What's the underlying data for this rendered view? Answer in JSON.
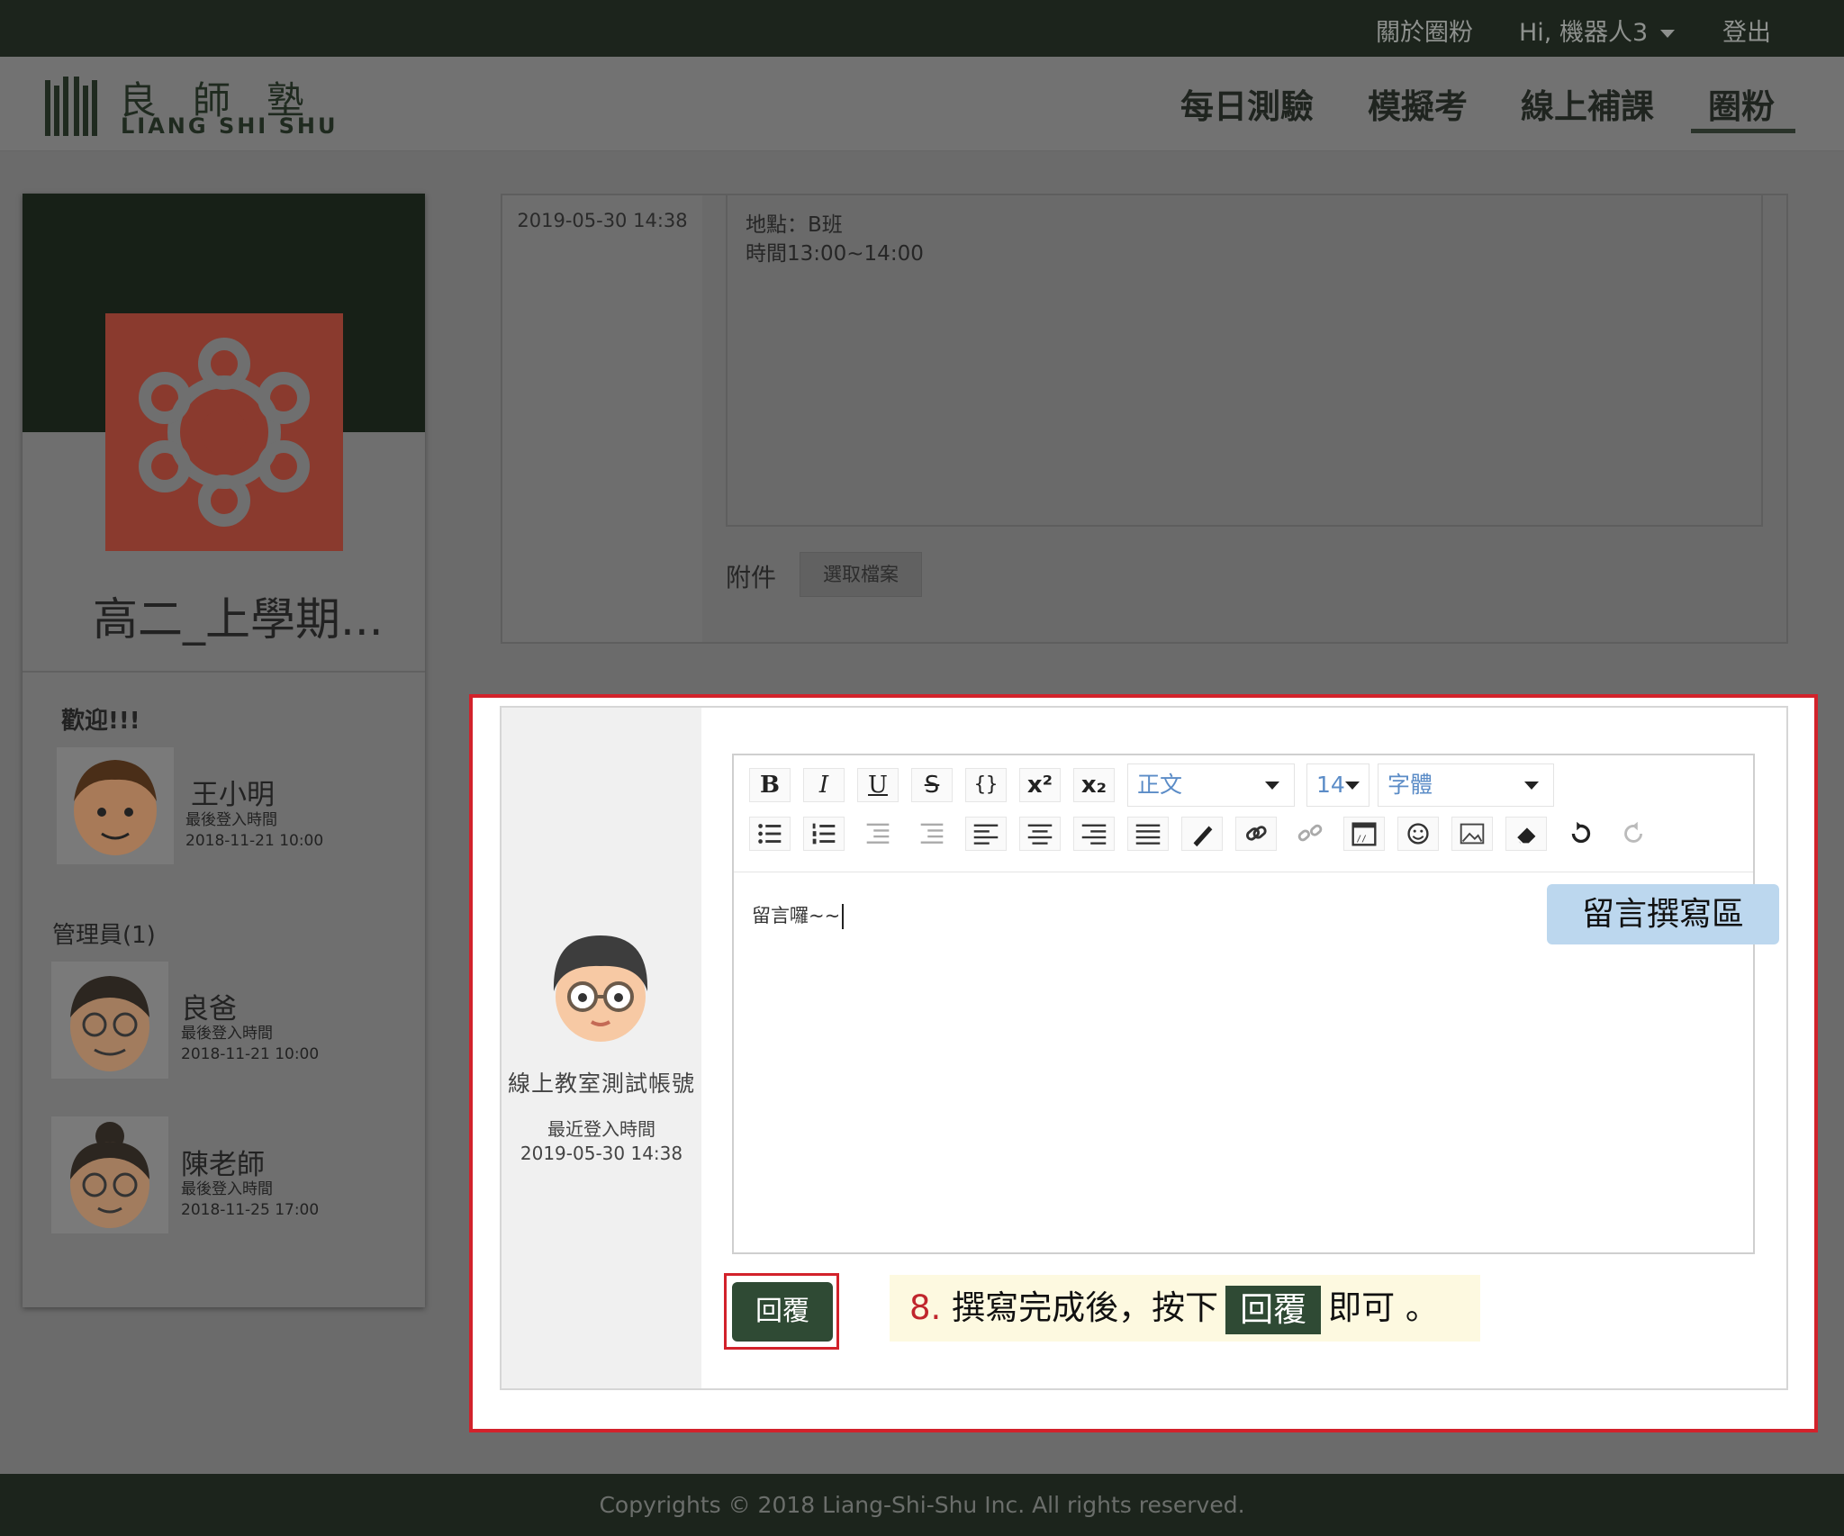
{
  "topbar": {
    "about": "關於圈粉",
    "greeting": "Hi, 機器人3",
    "logout": "登出"
  },
  "logo": {
    "cn": "良師塾",
    "en": "LIANG SHI SHU"
  },
  "nav": {
    "items": [
      "每日測驗",
      "模擬考",
      "線上補課",
      "圈粉"
    ],
    "active": "圈粉"
  },
  "sidebar": {
    "group_name": "高二_上學期...",
    "welcome": "歡迎!!!",
    "member": {
      "name": "王小明",
      "login_label": "最後登入時間",
      "login_time": "2018-11-21 10:00"
    },
    "admins_heading": "管理員(1)",
    "admins": [
      {
        "name": "良爸",
        "login_label": "最後登入時間",
        "login_time": "2018-11-21 10:00"
      },
      {
        "name": "陳老師",
        "login_label": "最後登入時間",
        "login_time": "2018-11-25 17:00"
      }
    ]
  },
  "upper_post": {
    "date": "2019-05-30 14:38",
    "lines": [
      "地點：B班",
      "時間13:00~14:00"
    ],
    "attach_label": "附件",
    "file_button": "選取檔案"
  },
  "reply": {
    "author": "線上教室測試帳號",
    "login_label": "最近登入時間",
    "login_time": "2019-05-30 14:38",
    "editor": {
      "format": "正文",
      "size": "14",
      "font": "字體",
      "content": "留言囉~~"
    },
    "button": "回覆"
  },
  "annotations": {
    "editor_label": "留言撰寫區",
    "step_number": "8.",
    "step_text_before": "撰寫完成後，按下",
    "step_pill": "回覆",
    "step_text_after": "即可 。"
  },
  "footer": {
    "copyright": "Copyrights © 2018 Liang-Shi-Shu Inc. All rights reserved."
  },
  "colors": {
    "dark_green": "#1c241c",
    "button_green": "#2f4a34",
    "highlight_red": "#d2222b",
    "callout_blue": "#bcd7ee",
    "callout_yellow": "#fdf9e0"
  }
}
